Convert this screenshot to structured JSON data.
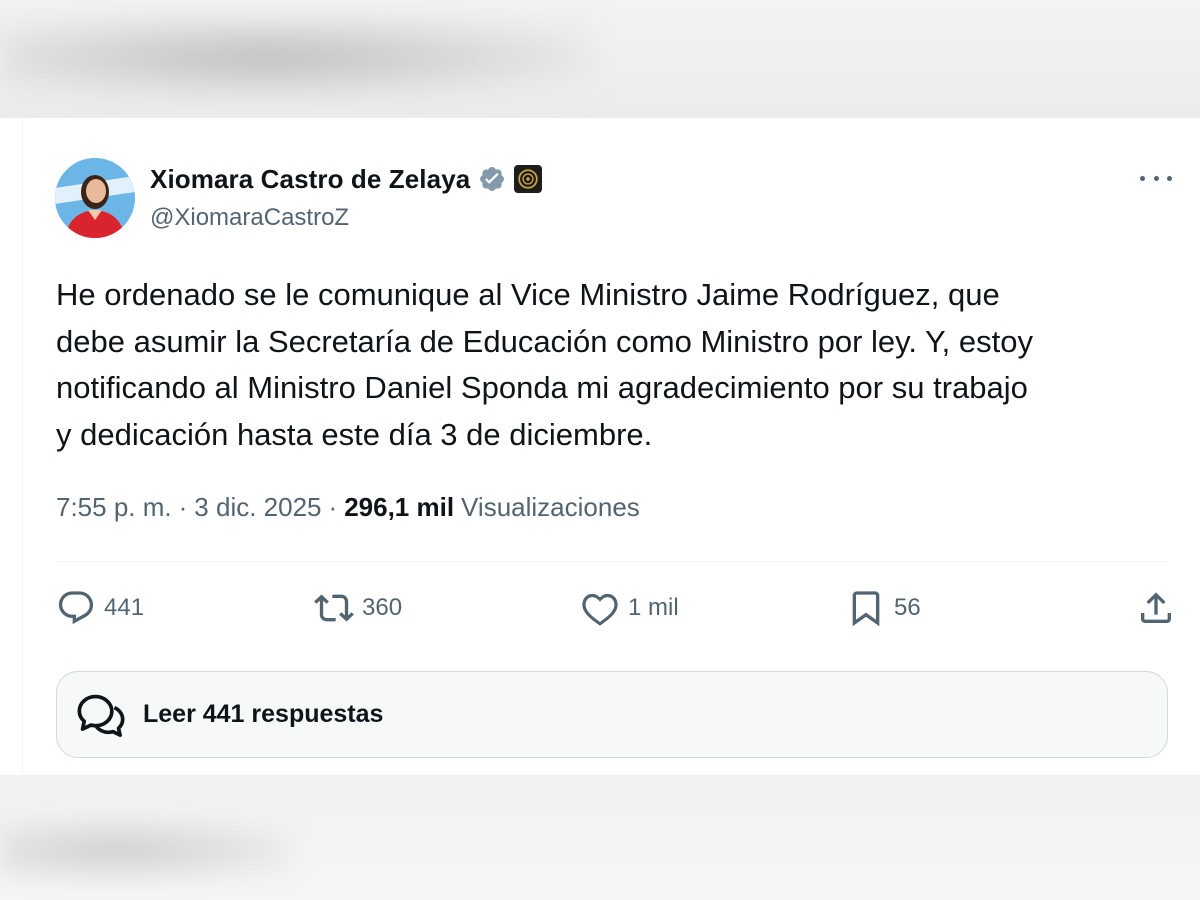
{
  "tweet": {
    "author": {
      "display_name": "Xiomara Castro de Zelaya",
      "handle": "@XiomaraCastroZ"
    },
    "text": "He ordenado se le comunique al Vice Ministro Jaime Rodríguez, que\ndebe asumir la Secretaría de Educación como Ministro por ley. Y, estoy\nnotificando al Ministro Daniel Sponda mi agradecimiento por su trabajo\ny dedicación hasta este día 3 de diciembre.",
    "time": "7:55 p. m.",
    "date": "3 dic. 2025",
    "separator": "·",
    "views_count": "296,1 mil",
    "views_label": "Visualizaciones",
    "actions": {
      "replies": "441",
      "retweets": "360",
      "likes": "1 mil",
      "bookmarks": "56"
    },
    "read_replies_label": "Leer 441 respuestas"
  },
  "colors": {
    "text_primary": "#0f1419",
    "text_secondary": "#536471",
    "verified_badge": "#829aab",
    "divider": "#eff3f4"
  },
  "icons": {
    "more": "more-horizontal-icon",
    "verified": "verified-badge-icon",
    "affiliate": "government-seal-icon",
    "reply": "reply-bubble-icon",
    "retweet": "retweet-icon",
    "like": "heart-icon",
    "bookmark": "bookmark-icon",
    "share": "share-icon",
    "read_replies": "chat-bubbles-icon"
  }
}
